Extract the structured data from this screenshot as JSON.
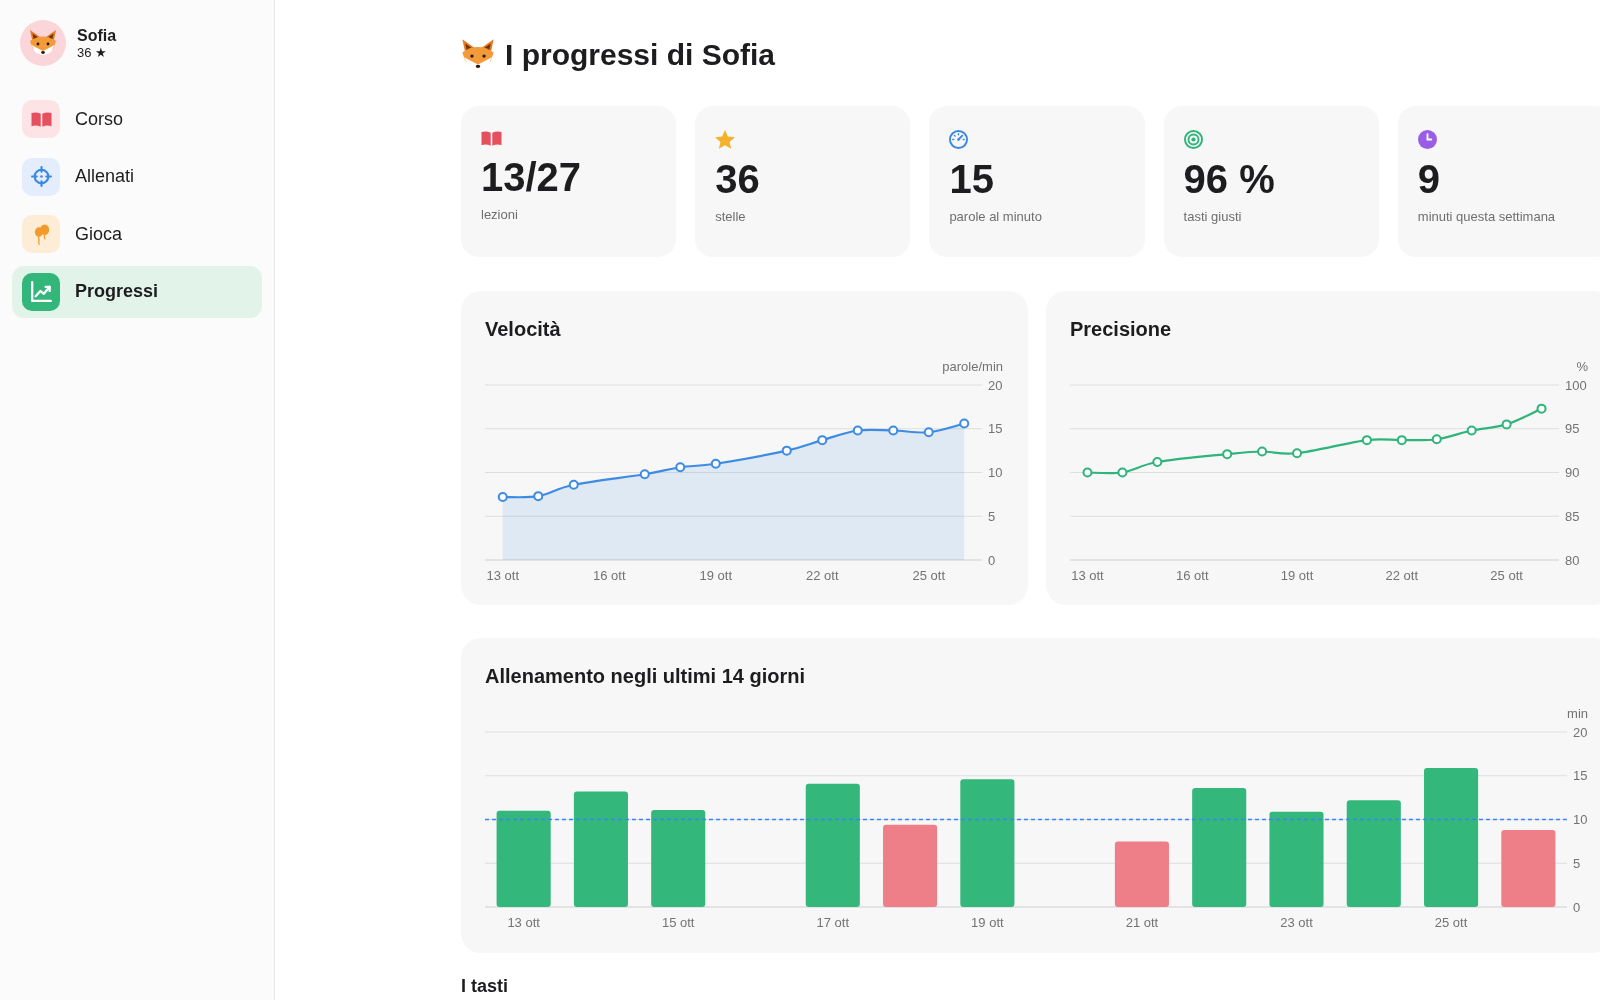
{
  "profile": {
    "name": "Sofia",
    "score": "36 ★"
  },
  "sidebar": {
    "items": [
      {
        "label": "Corso",
        "selected": false
      },
      {
        "label": "Allenati",
        "selected": false
      },
      {
        "label": "Gioca",
        "selected": false
      },
      {
        "label": "Progressi",
        "selected": true
      }
    ]
  },
  "page": {
    "title": "I progressi di Sofia"
  },
  "stats": [
    {
      "value": "13/27",
      "label": "lezioni"
    },
    {
      "value": "36",
      "label": "stelle"
    },
    {
      "value": "15",
      "label": "parole al minuto"
    },
    {
      "value": "96 %",
      "label": "tasti giusti"
    },
    {
      "value": "9",
      "label": "minuti questa settimana"
    }
  ],
  "charts": [
    {
      "chart_data": {
        "type": "area",
        "title": "Velocità",
        "ylabel": "parole/min",
        "x": [
          13,
          14,
          15,
          17,
          18,
          19,
          21,
          22,
          23,
          24,
          25,
          26
        ],
        "series": [
          {
            "color": "#3d8be3",
            "marker": "o",
            "values": [
              7.2,
              7.3,
              8.6,
              9.8,
              10.6,
              11.0,
              12.5,
              13.7,
              14.8,
              14.8,
              14.6,
              15.6
            ]
          }
        ],
        "xlim": [
          12.5,
          26.5
        ],
        "ylim": [
          0,
          20
        ],
        "xticks": [
          {
            "value": 13,
            "label": "13 ott"
          },
          {
            "value": 16,
            "label": "16 ott"
          },
          {
            "value": 19,
            "label": "19 ott"
          },
          {
            "value": 22,
            "label": "22 ott"
          },
          {
            "value": 25,
            "label": "25 ott"
          }
        ],
        "yticks": [
          0,
          5,
          10,
          15,
          20
        ],
        "grid": true
      }
    },
    {
      "chart_data": {
        "type": "line",
        "title": "Precisione",
        "ylabel": "%",
        "x": [
          13,
          14,
          15,
          17,
          18,
          19,
          21,
          22,
          23,
          24,
          25,
          26
        ],
        "series": [
          {
            "color": "#2fb47a",
            "marker": "o",
            "values": [
              90.0,
              90.0,
              91.2,
              92.1,
              92.4,
              92.2,
              93.7,
              93.7,
              93.8,
              94.8,
              95.5,
              97.3
            ]
          }
        ],
        "xlim": [
          12.5,
          26.5
        ],
        "ylim": [
          80,
          100
        ],
        "xticks": [
          {
            "value": 13,
            "label": "13 ott"
          },
          {
            "value": 16,
            "label": "16 ott"
          },
          {
            "value": 19,
            "label": "19 ott"
          },
          {
            "value": 22,
            "label": "22 ott"
          },
          {
            "value": 25,
            "label": "25 ott"
          }
        ],
        "yticks": [
          80,
          85,
          90,
          95,
          100
        ],
        "grid": true
      }
    }
  ],
  "training": {
    "chart_data": {
      "type": "bar",
      "title": "Allenamento negli ultimi 14 giorni",
      "ylabel": "min",
      "x": [
        13,
        14,
        15,
        17,
        18,
        19,
        21,
        22,
        23,
        24,
        25,
        26
      ],
      "series": [
        {
          "color": "#33b77b",
          "values": [
            11.0,
            13.2,
            11.1,
            14.1,
            null,
            14.6,
            null,
            13.6,
            10.9,
            12.2,
            15.9,
            null
          ]
        },
        {
          "color": "#ee7f88",
          "values": [
            null,
            null,
            null,
            null,
            9.4,
            null,
            7.5,
            null,
            null,
            null,
            null,
            8.8
          ]
        }
      ],
      "xlim": [
        12.5,
        26.5
      ],
      "ylim": [
        0,
        20
      ],
      "xticks": [
        {
          "value": 13,
          "label": "13 ott"
        },
        {
          "value": 15,
          "label": "15 ott"
        },
        {
          "value": 17,
          "label": "17 ott"
        },
        {
          "value": 19,
          "label": "19 ott"
        },
        {
          "value": 21,
          "label": "21 ott"
        },
        {
          "value": 23,
          "label": "23 ott"
        },
        {
          "value": 25,
          "label": "25 ott"
        }
      ],
      "yticks": [
        0,
        5,
        10,
        15,
        20
      ],
      "grid": true,
      "ref_lines": [
        {
          "axis": "y",
          "value": 10,
          "color": "#3b82f6"
        }
      ]
    }
  },
  "keys_section": {
    "title": "I tasti"
  }
}
